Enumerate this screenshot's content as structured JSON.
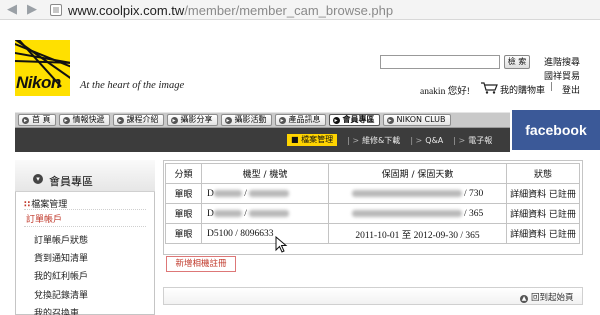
{
  "browser": {
    "url_host": "www.coolpix.com.tw",
    "url_path": "/member/member_cam_browse.php"
  },
  "brand": {
    "logo_text": "Nikon",
    "tagline": "At the heart of the image",
    "logo_color": "#ffe000"
  },
  "header": {
    "search_placeholder": "",
    "search_button": "檢 索",
    "advanced_search": "進階搜尋",
    "international_trade": "國祥貿易",
    "greeting": "anakin 您好!",
    "cart_label": "我的購物車",
    "separator": "|",
    "logout": "登出"
  },
  "main_nav": {
    "items": [
      {
        "label": "首 頁",
        "active": false
      },
      {
        "label": "情報快遞",
        "active": false
      },
      {
        "label": "課程介紹",
        "active": false
      },
      {
        "label": "攝影分享",
        "active": false
      },
      {
        "label": "攝影活動",
        "active": false
      },
      {
        "label": "產品訊息",
        "active": false
      },
      {
        "label": "會員專區",
        "active": true
      },
      {
        "label": "NIKON CLUB",
        "active": false
      }
    ]
  },
  "sub_nav": {
    "active": "檔案管理",
    "items": [
      "維修&下載",
      "Q&A",
      "電子報"
    ]
  },
  "facebook_label": "facebook",
  "sidebar": {
    "title": "會員專區",
    "section": "檔案管理",
    "current": "訂單帳戶",
    "items": [
      "訂單帳戶狀態",
      "貨到通知清單",
      "我的紅利帳戶",
      "兌換記錄清單",
      "我的召換車"
    ]
  },
  "table": {
    "headers": [
      "分類",
      "機型 / 機號",
      "保固期 / 保固天數",
      "狀態"
    ],
    "rows": [
      {
        "type": "單眼",
        "model": "D",
        "model_blurred": true,
        "period": "/ 730",
        "period_blurred": true,
        "status": "詳細資料 已註冊"
      },
      {
        "type": "單眼",
        "model": "D",
        "model_blurred": true,
        "period": "/ 365",
        "period_blurred": true,
        "status": "詳細資料 已註冊"
      },
      {
        "type": "單眼",
        "model": "D5100 / 8096633",
        "model_blurred": false,
        "period": "2011-10-01 至 2012-09-30 / 365",
        "period_blurred": false,
        "status": "詳細資料 已註冊"
      }
    ]
  },
  "add_button": "新增相機註冊",
  "back_to_top": "回到起始頁",
  "colors": {
    "accent_red": "#c0392b",
    "subnav_active": "#ffd400",
    "facebook_blue": "#3b5998"
  }
}
